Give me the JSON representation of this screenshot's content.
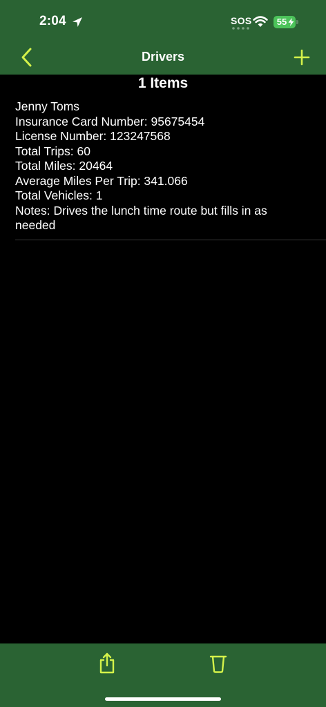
{
  "status_bar": {
    "time": "2:04",
    "sos": "SOS",
    "battery_level": "55",
    "icons": [
      "location-arrow-icon",
      "wifi-icon",
      "battery-icon",
      "charging-bolt-icon"
    ]
  },
  "nav": {
    "title": "Drivers",
    "back_icon": "chevron-left-icon",
    "add_icon": "plus-icon"
  },
  "list": {
    "count_label": "1 Items",
    "items": [
      {
        "name": "Jenny Toms",
        "insurance": "Insurance Card Number: 95675454",
        "license": "License Number: 123247568",
        "trips": "Total Trips: 60",
        "miles": "Total Miles: 20464",
        "avg_miles": "Average Miles Per Trip: 341.066",
        "vehicles": "Total Vehicles: 1",
        "notes": "Notes: Drives the lunch time route but fills in as needed"
      }
    ]
  },
  "toolbar": {
    "share_icon": "share-icon",
    "trash_icon": "trash-icon"
  },
  "colors": {
    "bar_green": "#2a6333",
    "accent_yellow": "#d4f24a",
    "background": "#000000",
    "text": "#ffffff",
    "battery_green": "#4cc35a"
  }
}
